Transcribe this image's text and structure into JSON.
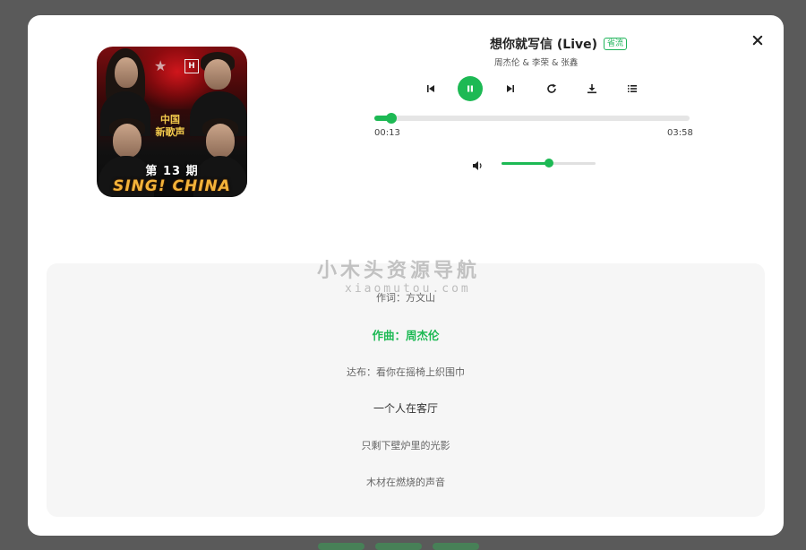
{
  "player": {
    "title": "想你就写信 (Live)",
    "quality": "省流",
    "artists": "周杰伦 & 李荣 & 张鑫",
    "cover": {
      "episode": "第 13 期",
      "show_logo": "SING! CHINA",
      "badge_text": "中国\n新歌声",
      "channel_mark": "H"
    },
    "controls": [
      "previous-icon",
      "pause-icon",
      "next-icon",
      "repeat-icon",
      "download-icon",
      "playlist-icon"
    ],
    "elapsed": "00:13",
    "duration": "03:58",
    "progress_fraction": 0.055,
    "volume_fraction": 0.5,
    "accent_color": "#1db954"
  },
  "lyrics": [
    "作词：方文山",
    "作曲：周杰伦",
    "达布：看你在摇椅上织围巾",
    "一个人在客厅",
    "只剩下壁炉里的光影",
    "木材在燃烧的声音"
  ],
  "lyrics_active_index": 1,
  "watermark": {
    "title": "小木头资源导航",
    "url": "xiaomutou.com"
  }
}
